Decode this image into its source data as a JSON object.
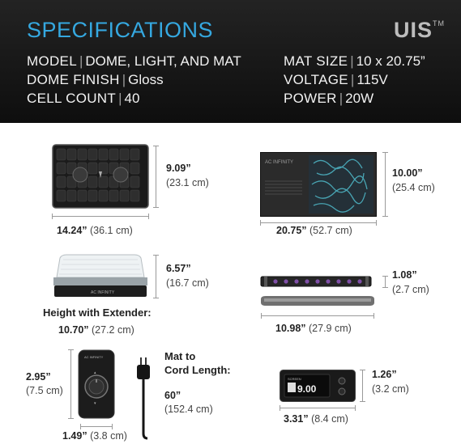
{
  "header": {
    "title": "SPECIFICATIONS",
    "brand": "UIS",
    "brand_tm": "TM",
    "specs_left": [
      {
        "label": "MODEL",
        "value": "DOME, LIGHT, AND MAT"
      },
      {
        "label": "DOME FINISH",
        "value": "Gloss"
      },
      {
        "label": "CELL COUNT",
        "value": "40"
      }
    ],
    "specs_right": [
      {
        "label": "MAT SIZE",
        "value": "10 x 20.75”"
      },
      {
        "label": "VOLTAGE",
        "value": "115V"
      },
      {
        "label": "POWER",
        "value": "20W"
      }
    ]
  },
  "tray": {
    "height_in": "9.09”",
    "height_cm": "(23.1 cm)",
    "width_in": "14.24”",
    "width_cm": "(36.1 cm)"
  },
  "mat": {
    "height_in": "10.00”",
    "height_cm": "(25.4 cm)",
    "width_in": "20.75”",
    "width_cm": "(52.7 cm)",
    "brand_text": "AC INFINITY"
  },
  "dome": {
    "height_in": "6.57”",
    "height_cm": "(16.7 cm)",
    "extender_label": "Height with Extender:",
    "extender_in": "10.70”",
    "extender_cm": "(27.2 cm)",
    "brand_text": "AC INFINITY"
  },
  "light": {
    "height_in": "1.08”",
    "height_cm": "(2.7 cm)",
    "width_in": "10.98”",
    "width_cm": "(27.9 cm)"
  },
  "controller": {
    "height_in": "2.95”",
    "height_cm": "(7.5 cm)",
    "width_in": "1.49”",
    "width_cm": "(3.8 cm)",
    "brand_text": "AC INFINITY",
    "cord_label_1": "Mat to",
    "cord_label_2": "Cord Length:",
    "cord_in": "60”",
    "cord_cm": "(152.4 cm)"
  },
  "display": {
    "height_in": "1.26”",
    "height_cm": "(3.2 cm)",
    "width_in": "3.31”",
    "width_cm": "(8.4 cm)",
    "screen_value": "9.00",
    "screen_label": "SCREEN"
  }
}
